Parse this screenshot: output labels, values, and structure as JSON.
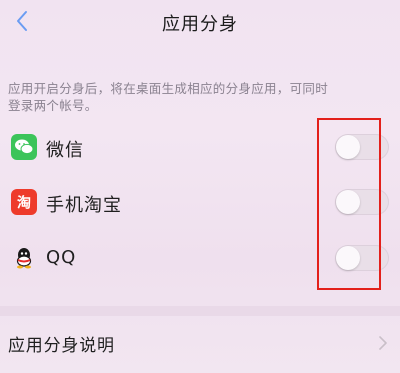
{
  "header": {
    "back_icon": "chevron-left-icon",
    "title": "应用分身"
  },
  "description": {
    "line1": "应用开启分身后，将在桌面生成相应的分身应用，可同时",
    "line2": "登录两个帐号。"
  },
  "apps": [
    {
      "name": "微信",
      "icon": "wechat-icon",
      "enabled": false,
      "color": "#3cc45a"
    },
    {
      "name": "手机淘宝",
      "icon": "taobao-icon",
      "enabled": false,
      "color": "#ee3b2b"
    },
    {
      "name": "QQ",
      "icon": "qq-icon",
      "enabled": false,
      "color": "#1a1a1a"
    }
  ],
  "explain": {
    "label": "应用分身说明",
    "chevron_icon": "chevron-right-icon"
  },
  "colors": {
    "accent_back": "#4f8df0",
    "highlight_box": "#e3201b"
  }
}
